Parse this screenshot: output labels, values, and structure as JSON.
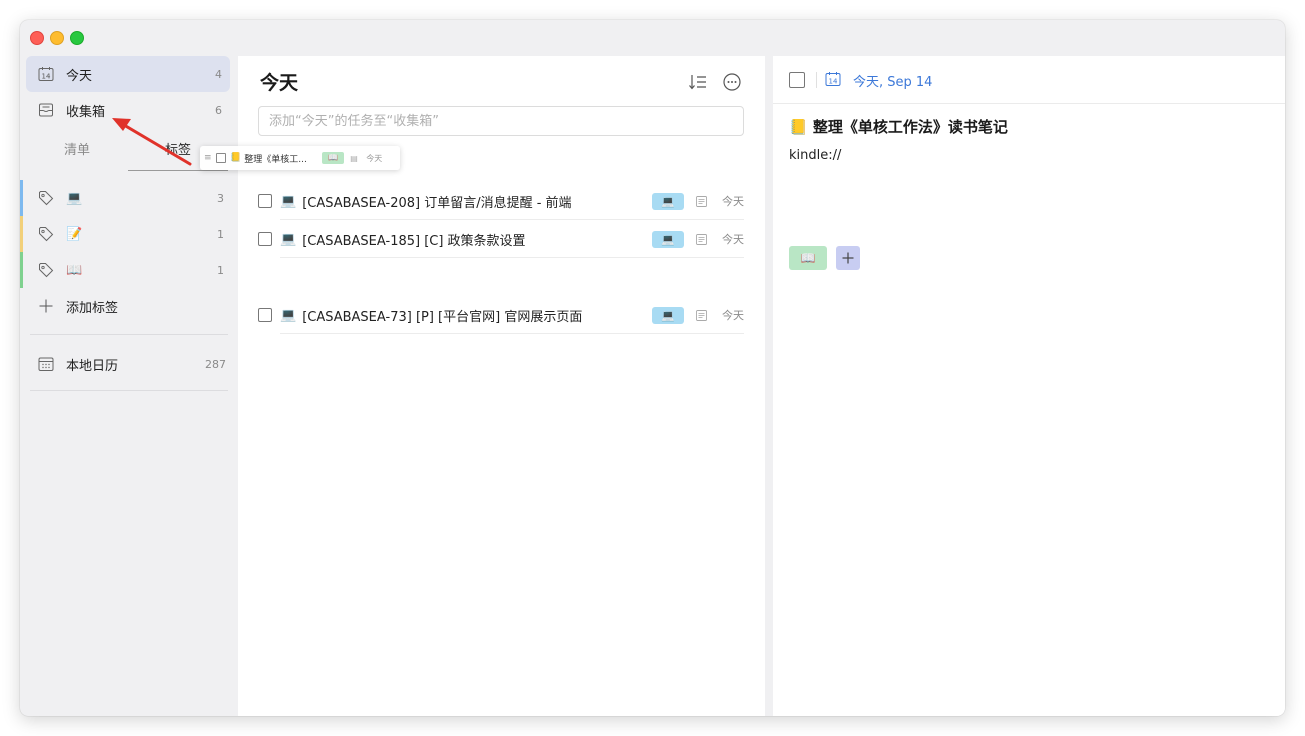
{
  "sidebar": {
    "today": {
      "label": "今天",
      "count": "4",
      "icon_num": "14"
    },
    "inbox": {
      "label": "收集箱",
      "count": "6"
    },
    "tabs": {
      "list": "清单",
      "tags": "标签"
    },
    "tags": [
      {
        "emoji": "💻",
        "count": "3",
        "color": "#7db9ef"
      },
      {
        "emoji": "📝",
        "count": "1",
        "color": "#f2d07a"
      },
      {
        "emoji": "📖",
        "count": "1",
        "color": "#7fd18f"
      }
    ],
    "add_tag": "添加标签",
    "calendar": {
      "label": "本地日历",
      "count": "287"
    }
  },
  "middle": {
    "title": "今天",
    "input_placeholder": "添加“今天”的任务至“收集箱”",
    "tasks": [
      {
        "emoji": "💻",
        "title": "[CASABASEA-208] 订单留言/消息提醒 - 前端",
        "tag": "💻",
        "date": "今天"
      },
      {
        "emoji": "💻",
        "title": "[CASABASEA-185] [C] 政策条款设置",
        "tag": "💻",
        "date": "今天"
      },
      {
        "emoji": "💻",
        "title": "[CASABASEA-73] [P] [平台官网] 官网展示页面",
        "tag": "💻",
        "date": "今天"
      }
    ]
  },
  "drag": {
    "handle": "≡",
    "emoji": "📒",
    "title": "整理《单核工...",
    "tag": "📖",
    "note": "▤",
    "date": "今天"
  },
  "detail": {
    "cal_num": "14",
    "date": "今天, Sep 14",
    "emoji": "📒",
    "title": "整理《单核工作法》读书笔记",
    "note": "kindle://",
    "tag": "📖",
    "add_tag": "+"
  },
  "colors": {
    "accent": "#3c78d8",
    "arrow": "#e0322a",
    "task_tag": "#a8dbf3",
    "book_tag": "#b9e6c5"
  }
}
